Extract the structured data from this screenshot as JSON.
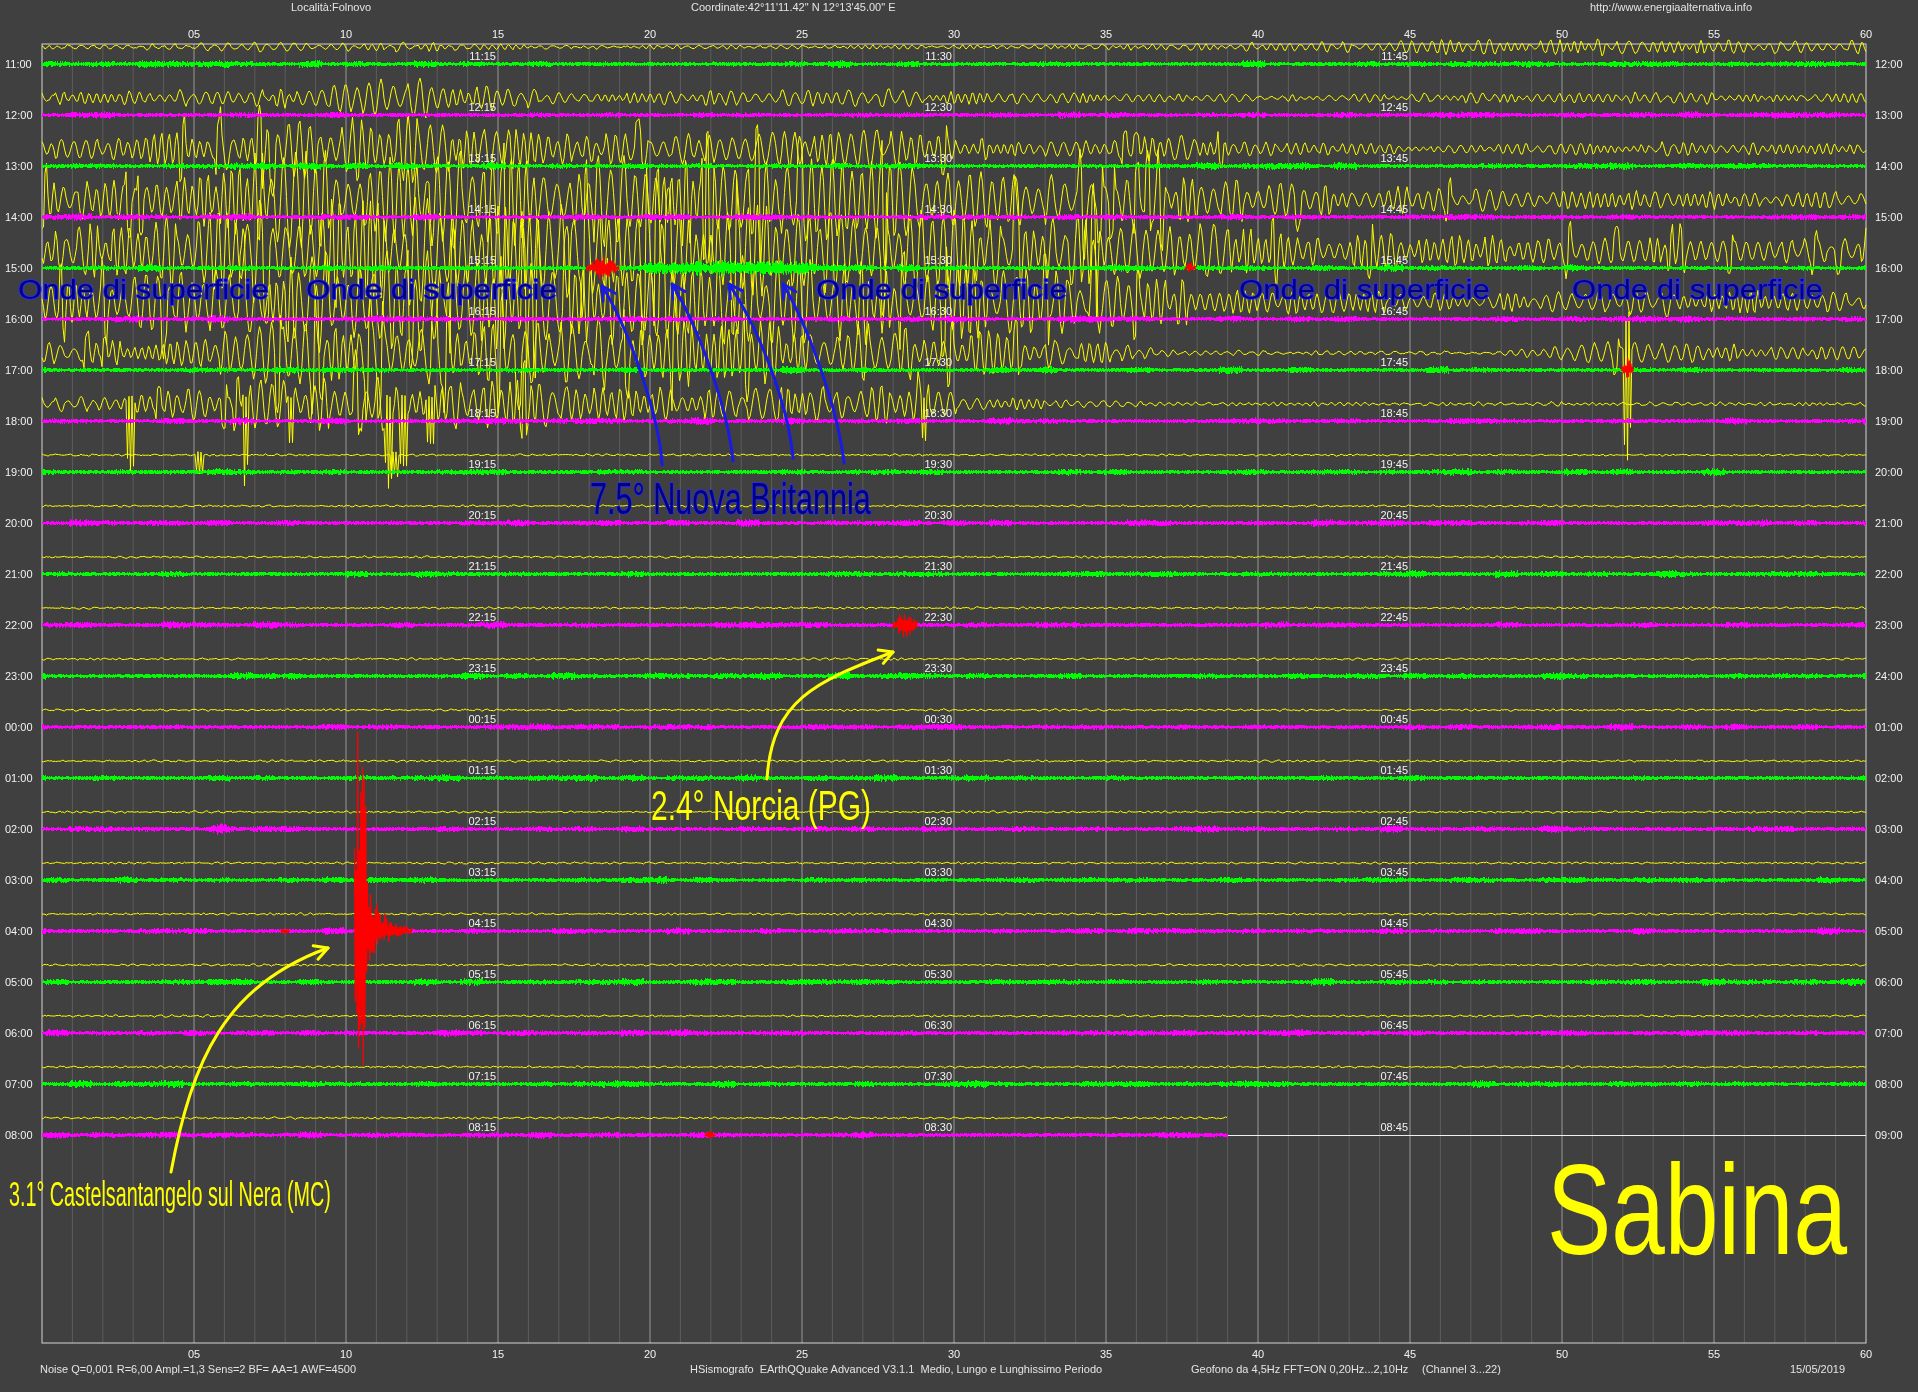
{
  "header": {
    "location": "Località:Folnovo",
    "coordinates": "Coordinate:42°11'11.42\" N 12°13'45.00\" E",
    "website": "http://www.energiaalternativa.info"
  },
  "top_axis": {
    "ticks": [
      "05",
      "10",
      "15",
      "20",
      "25",
      "30",
      "35",
      "40",
      "45",
      "50",
      "55",
      "60"
    ]
  },
  "rows": [
    {
      "start": "11:00",
      "end": "12:00",
      "quarters": [
        "11:15",
        "11:30",
        "11:45"
      ],
      "color": "#00ff00",
      "level": 1
    },
    {
      "start": "12:00",
      "end": "13:00",
      "quarters": [
        "12:15",
        "12:30",
        "12:45"
      ],
      "color": "#ff00ff",
      "level": 1
    },
    {
      "start": "13:00",
      "end": "14:00",
      "quarters": [
        "13:15",
        "13:30",
        "13:45"
      ],
      "color": "#00ff00",
      "level": 1
    },
    {
      "start": "14:00",
      "end": "15:00",
      "quarters": [
        "14:15",
        "14:30",
        "14:45"
      ],
      "color": "#ff00ff",
      "level": 1
    },
    {
      "start": "15:00",
      "end": "16:00",
      "quarters": [
        "15:15",
        "15:30",
        "15:45"
      ],
      "color": "#00ff00",
      "level": 1
    },
    {
      "start": "16:00",
      "end": "17:00",
      "quarters": [
        "16:15",
        "16:30",
        "16:45"
      ],
      "color": "#ff00ff",
      "level": 1
    },
    {
      "start": "17:00",
      "end": "18:00",
      "quarters": [
        "17:15",
        "17:30",
        "17:45"
      ],
      "color": "#00ff00",
      "level": 1
    },
    {
      "start": "18:00",
      "end": "19:00",
      "quarters": [
        "18:15",
        "18:30",
        "18:45"
      ],
      "color": "#ff00ff",
      "level": 1
    },
    {
      "start": "19:00",
      "end": "20:00",
      "quarters": [
        "19:15",
        "19:30",
        "19:45"
      ],
      "color": "#00ff00",
      "level": 1
    },
    {
      "start": "20:00",
      "end": "21:00",
      "quarters": [
        "20:15",
        "20:30",
        "20:45"
      ],
      "color": "#ff00ff",
      "level": 1
    },
    {
      "start": "21:00",
      "end": "22:00",
      "quarters": [
        "21:15",
        "21:30",
        "21:45"
      ],
      "color": "#00ff00",
      "level": 1
    },
    {
      "start": "22:00",
      "end": "23:00",
      "quarters": [
        "22:15",
        "22:30",
        "22:45"
      ],
      "color": "#ff00ff",
      "level": 1
    },
    {
      "start": "23:00",
      "end": "24:00",
      "quarters": [
        "23:15",
        "23:30",
        "23:45"
      ],
      "color": "#00ff00",
      "level": 1
    },
    {
      "start": "00:00",
      "end": "01:00",
      "quarters": [
        "00:15",
        "00:30",
        "00:45"
      ],
      "color": "#ff00ff",
      "level": 1
    },
    {
      "start": "01:00",
      "end": "02:00",
      "quarters": [
        "01:15",
        "01:30",
        "01:45"
      ],
      "color": "#00ff00",
      "level": 1
    },
    {
      "start": "02:00",
      "end": "03:00",
      "quarters": [
        "02:15",
        "02:30",
        "02:45"
      ],
      "color": "#ff00ff",
      "level": 1
    },
    {
      "start": "03:00",
      "end": "04:00",
      "quarters": [
        "03:15",
        "03:30",
        "03:45"
      ],
      "color": "#00ff00",
      "level": 1
    },
    {
      "start": "04:00",
      "end": "05:00",
      "quarters": [
        "04:15",
        "04:30",
        "04:45"
      ],
      "color": "#ff00ff",
      "level": 1
    },
    {
      "start": "05:00",
      "end": "06:00",
      "quarters": [
        "05:15",
        "05:30",
        "05:45"
      ],
      "color": "#00ff00",
      "level": 1
    },
    {
      "start": "06:00",
      "end": "07:00",
      "quarters": [
        "06:15",
        "06:30",
        "06:45"
      ],
      "color": "#ff00ff",
      "level": 1
    },
    {
      "start": "07:00",
      "end": "08:00",
      "quarters": [
        "07:15",
        "07:30",
        "07:45"
      ],
      "color": "#00ff00",
      "level": 1
    },
    {
      "start": "08:00",
      "end": "09:00",
      "quarters": [
        "08:15",
        "08:30",
        "08:45"
      ],
      "color": "#ff00ff",
      "level": 0.65
    }
  ],
  "surface_wave_labels": [
    "Onde di superficie",
    "Onde di superficie",
    "Onde di superficie",
    "Onde di superficie",
    "Onde di superficie"
  ],
  "event_labels": [
    {
      "kind": "distant",
      "text": "7.5° Nuova Britannia"
    },
    {
      "kind": "local",
      "text": "2.4° Norcia (PG)"
    },
    {
      "kind": "local",
      "text": "3.1° Castelsantangelo sul Nera (MC)"
    }
  ],
  "station": "Sabina",
  "bottom_axis": {
    "ticks": [
      "05",
      "10",
      "15",
      "20",
      "25",
      "30",
      "35",
      "40",
      "45",
      "50",
      "55",
      "60"
    ]
  },
  "footer": {
    "settings": "Noise Q=0,001 R=6,00 Ampl.=1,3 Sens=2 BF= AA=1 AWF=4500",
    "software": "HSismografo  EArthQQuake Advanced V3.1.1  Medio, Lungo e Lunghissimo Periodo",
    "sensor": "Geofono da 4,5Hz FFT=ON 0,20Hz...2,10Hz",
    "channels": "(Channel 3...22)",
    "date": "15/05/2019"
  }
}
